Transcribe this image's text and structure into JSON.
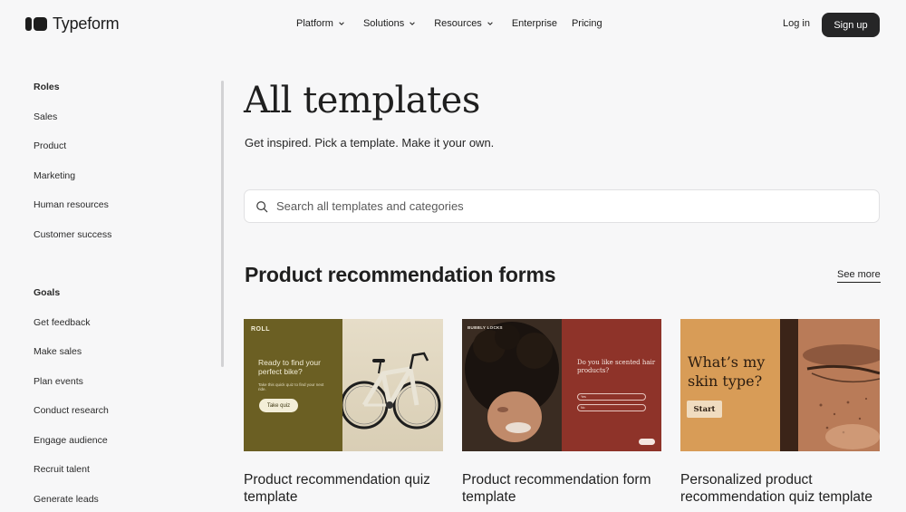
{
  "header": {
    "brand": "Typeform",
    "nav": [
      {
        "label": "Platform",
        "has_dropdown": true
      },
      {
        "label": "Solutions",
        "has_dropdown": true
      },
      {
        "label": "Resources",
        "has_dropdown": true
      },
      {
        "label": "Enterprise",
        "has_dropdown": false
      },
      {
        "label": "Pricing",
        "has_dropdown": false
      }
    ],
    "login": "Log in",
    "signup": "Sign up"
  },
  "sidebar": {
    "roles_heading": "Roles",
    "roles": [
      "Sales",
      "Product",
      "Marketing",
      "Human resources",
      "Customer success"
    ],
    "goals_heading": "Goals",
    "goals": [
      "Get feedback",
      "Make sales",
      "Plan events",
      "Conduct research",
      "Engage audience",
      "Recruit talent",
      "Generate leads"
    ]
  },
  "main": {
    "title": "All templates",
    "subtitle": "Get inspired. Pick a template. Make it your own.",
    "search_placeholder": "Search all templates and categories",
    "section_title": "Product recommendation forms",
    "see_more": "See more"
  },
  "cards": [
    {
      "title": "Product recommendation quiz template",
      "preview": {
        "brand": "ROLL",
        "question": "Ready to find your perfect bike?",
        "small_text": "Take this quick quiz to find your next ride.",
        "button": "Take quiz"
      }
    },
    {
      "title": "Product recommendation form template",
      "preview": {
        "brand": "BUBBLY LOCKS",
        "question": "Do you like scented hair products?",
        "field1": "Yes",
        "field2": "No"
      }
    },
    {
      "title": "Personalized product recommendation quiz template",
      "preview": {
        "question": "What’s my skin type?",
        "button": "Start"
      }
    }
  ],
  "colors": {
    "background": "#f7f7f8",
    "signup_bg": "#262627",
    "card1_panel": "#6b5f23",
    "card2_panel": "#8e3329",
    "card3_panel": "#d89c57"
  }
}
